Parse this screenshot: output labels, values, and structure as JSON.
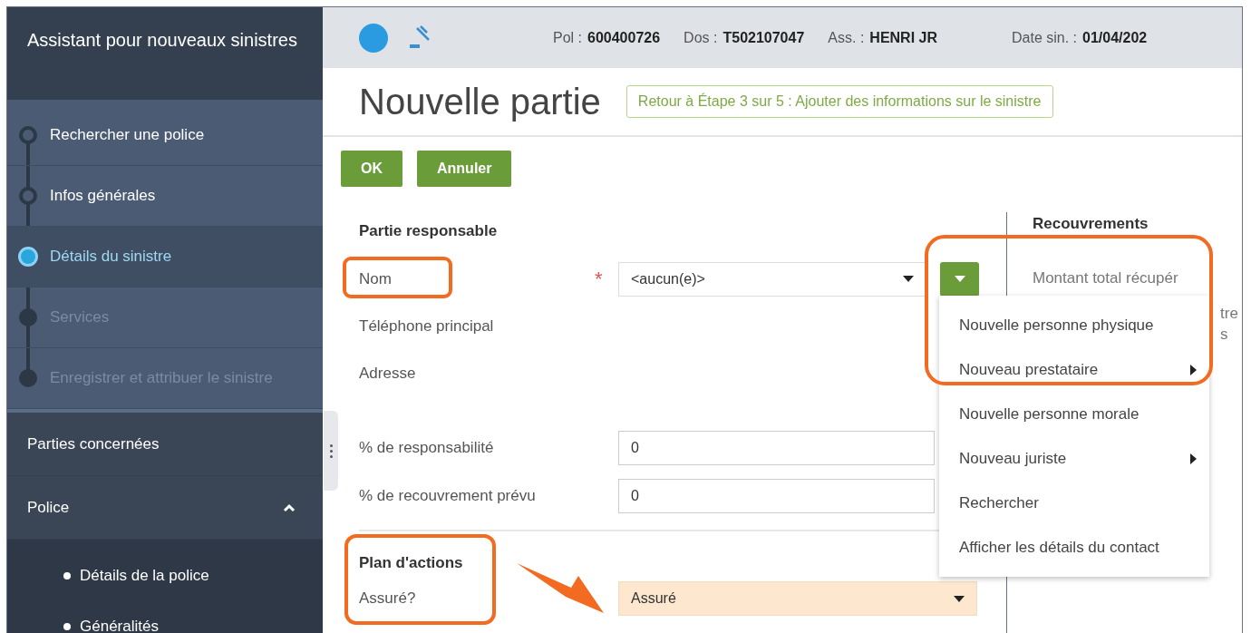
{
  "sidebar": {
    "title": "Assistant pour nouveaux sinistres",
    "steps": [
      {
        "label": "Rechercher une police",
        "current": false,
        "disabled": false
      },
      {
        "label": "Infos générales",
        "current": false,
        "disabled": false
      },
      {
        "label": "Détails du sinistre",
        "current": true,
        "disabled": false
      },
      {
        "label": "Services",
        "current": false,
        "disabled": true
      },
      {
        "label": "Enregistrer et attribuer le sinistre",
        "current": false,
        "disabled": true
      }
    ],
    "nav": [
      {
        "label": "Parties concernées"
      },
      {
        "label": "Police",
        "expanded": true,
        "children": [
          {
            "label": "Détails de la police"
          },
          {
            "label": "Généralités"
          }
        ]
      }
    ]
  },
  "header": {
    "fields": [
      {
        "label": "Pol :",
        "value": "600400726"
      },
      {
        "label": "Dos :",
        "value": "T502107047"
      },
      {
        "label": "Ass. :",
        "value": "HENRI JR"
      },
      {
        "label": "Date sin. :",
        "value": "01/04/202"
      }
    ]
  },
  "page": {
    "title": "Nouvelle partie",
    "back_link": "Retour à Étape 3 sur 5 : Ajouter des informations sur le sinistre",
    "buttons": [
      "OK",
      "Annuler"
    ]
  },
  "form": {
    "section": "Partie responsable",
    "fields": [
      {
        "label": "Nom",
        "kind": "select",
        "value": "<aucun(e)>",
        "required_mark": "*"
      },
      {
        "label": "Téléphone principal",
        "kind": "text"
      },
      {
        "label": "Adresse",
        "kind": "text"
      },
      {
        "label": "% de responsabilité",
        "kind": "input",
        "value": "0"
      },
      {
        "label": "% de recouvrement prévu",
        "kind": "input",
        "value": "0"
      }
    ],
    "section_2": "Plan d'actions",
    "fields_2": [
      {
        "label": "Assuré?",
        "kind": "select",
        "value": "Assuré",
        "highlighted": true
      }
    ]
  },
  "right_panel": {
    "title": "Recouvrements",
    "label": "Montant total récupér",
    "fragments": [
      "tre",
      "s"
    ]
  },
  "menu": {
    "items": [
      {
        "label": "Nouvelle personne physique",
        "submenu": false
      },
      {
        "label": "Nouveau prestataire",
        "submenu": true
      },
      {
        "label": "Nouvelle personne morale",
        "submenu": false
      },
      {
        "label": "Nouveau juriste",
        "submenu": true
      },
      {
        "label": "Rechercher",
        "submenu": false
      },
      {
        "label": "Afficher les détails du contact",
        "submenu": false
      }
    ]
  }
}
